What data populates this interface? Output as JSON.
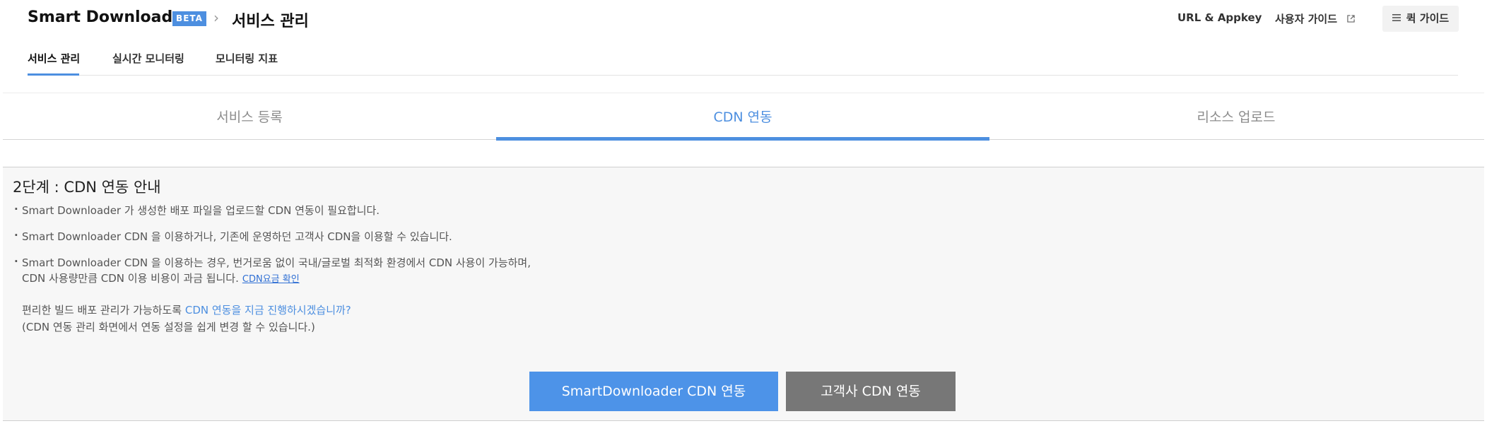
{
  "header": {
    "brand": "Smart Downloader",
    "badge": "BETA",
    "breadcrumb_sep": "›",
    "breadcrumb_current": "서비스 관리",
    "links": {
      "url_appkey": "URL & Appkey",
      "user_guide": "사용자 가이드",
      "quick_guide": "퀵 가이드"
    }
  },
  "subnav": {
    "items": [
      "서비스 관리",
      "실시간 모니터링",
      "모니터링 지표"
    ],
    "active_index": 0
  },
  "steps": {
    "items": [
      "서비스 등록",
      "CDN 연동",
      "리소스 업로드"
    ],
    "active_index": 1
  },
  "panel": {
    "title": "2단계 : CDN 연동 안내",
    "bullets": [
      "Smart Downloader 가 생성한 배포 파일을 업로드할 CDN 연동이 필요합니다.",
      "Smart Downloader CDN 을 이용하거나, 기존에 운영하던 고객사 CDN을 이용할 수 있습니다.",
      "Smart Downloader CDN 을 이용하는 경우, 번거로움 없이 국내/글로벌 최적화 환경에서 CDN 사용이 가능하며,"
    ],
    "bullet3_line2": "CDN 사용량만큼 CDN 이용 비용이 과금 됩니다.",
    "price_link": "CDN요금 확인",
    "note_prefix": "편리한 빌드 배포 관리가 가능하도록 ",
    "note_highlight": "CDN 연동을 지금 진행하시겠습니까?",
    "note_line2": "(CDN 연동 관리 화면에서 연동 설정을 쉽게 변경 할 수 있습니다.)",
    "buttons": {
      "primary": "SmartDownloader CDN 연동",
      "secondary": "고객사 CDN 연동"
    }
  },
  "colors": {
    "accent": "#4d8fe0",
    "secondary_button": "#777777",
    "panel_bg": "#f7f7f7"
  }
}
